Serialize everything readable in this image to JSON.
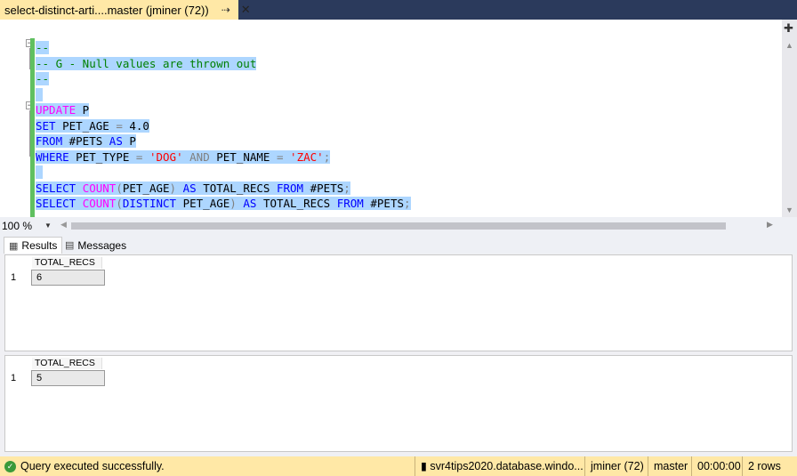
{
  "tab": {
    "title": "select-distinct-arti....master (jminer (72))",
    "pin_icon": "pin-icon",
    "close_icon": "close-icon"
  },
  "editor": {
    "lines": [
      {
        "parts": [
          {
            "t": "--",
            "c": "cm"
          }
        ]
      },
      {
        "parts": [
          {
            "t": "-- G - Null values are thrown out",
            "c": "cm"
          }
        ]
      },
      {
        "parts": [
          {
            "t": "--",
            "c": "cm"
          }
        ]
      },
      {
        "parts": []
      },
      {
        "parts": [
          {
            "t": "UPDATE",
            "c": "fn"
          },
          {
            "t": " P",
            "c": "tx"
          }
        ]
      },
      {
        "parts": [
          {
            "t": "SET",
            "c": "kw"
          },
          {
            "t": " PET_AGE ",
            "c": "tx"
          },
          {
            "t": "=",
            "c": "op"
          },
          {
            "t": " 4.0",
            "c": "tx"
          }
        ]
      },
      {
        "parts": [
          {
            "t": "FROM",
            "c": "kw"
          },
          {
            "t": " #PETS ",
            "c": "tx"
          },
          {
            "t": "AS",
            "c": "kw"
          },
          {
            "t": " P",
            "c": "tx"
          }
        ]
      },
      {
        "parts": [
          {
            "t": "WHERE",
            "c": "kw"
          },
          {
            "t": " PET_TYPE ",
            "c": "tx"
          },
          {
            "t": "=",
            "c": "op"
          },
          {
            "t": " ",
            "c": "tx"
          },
          {
            "t": "'DOG'",
            "c": "str"
          },
          {
            "t": " ",
            "c": "tx"
          },
          {
            "t": "AND",
            "c": "op"
          },
          {
            "t": " PET_NAME ",
            "c": "tx"
          },
          {
            "t": "=",
            "c": "op"
          },
          {
            "t": " ",
            "c": "tx"
          },
          {
            "t": "'ZAC'",
            "c": "str"
          },
          {
            "t": ";",
            "c": "op"
          }
        ]
      },
      {
        "parts": []
      },
      {
        "parts": [
          {
            "t": "SELECT",
            "c": "kw"
          },
          {
            "t": " ",
            "c": "tx"
          },
          {
            "t": "COUNT",
            "c": "fn"
          },
          {
            "t": "(",
            "c": "op"
          },
          {
            "t": "PET_AGE",
            "c": "tx"
          },
          {
            "t": ")",
            "c": "op"
          },
          {
            "t": " ",
            "c": "tx"
          },
          {
            "t": "AS",
            "c": "kw"
          },
          {
            "t": " TOTAL_RECS ",
            "c": "tx"
          },
          {
            "t": "FROM",
            "c": "kw"
          },
          {
            "t": " #PETS",
            "c": "tx"
          },
          {
            "t": ";",
            "c": "op"
          }
        ]
      },
      {
        "parts": [
          {
            "t": "SELECT",
            "c": "kw"
          },
          {
            "t": " ",
            "c": "tx"
          },
          {
            "t": "COUNT",
            "c": "fn"
          },
          {
            "t": "(",
            "c": "op"
          },
          {
            "t": "DISTINCT",
            "c": "kw"
          },
          {
            "t": " PET_AGE",
            "c": "tx"
          },
          {
            "t": ")",
            "c": "op"
          },
          {
            "t": " ",
            "c": "tx"
          },
          {
            "t": "AS",
            "c": "kw"
          },
          {
            "t": " TOTAL_RECS ",
            "c": "tx"
          },
          {
            "t": "FROM",
            "c": "kw"
          },
          {
            "t": " #PETS",
            "c": "tx"
          },
          {
            "t": ";",
            "c": "op"
          }
        ]
      }
    ]
  },
  "zoom": {
    "value": "100 %"
  },
  "results_tabs": [
    {
      "label": "Results",
      "icon": "grid-icon"
    },
    {
      "label": "Messages",
      "icon": "messages-icon"
    }
  ],
  "result_sets": [
    {
      "column": "TOTAL_RECS",
      "row_number": "1",
      "value": "6"
    },
    {
      "column": "TOTAL_RECS",
      "row_number": "1",
      "value": "5"
    }
  ],
  "status": {
    "message": "Query executed successfully.",
    "server": "svr4tips2020.database.windo...",
    "user": "jminer (72)",
    "database": "master",
    "elapsed": "00:00:00",
    "rows": "2 rows",
    "colors": {
      "bar": "#ffe8a6",
      "ok": "#3a9a3a"
    }
  }
}
